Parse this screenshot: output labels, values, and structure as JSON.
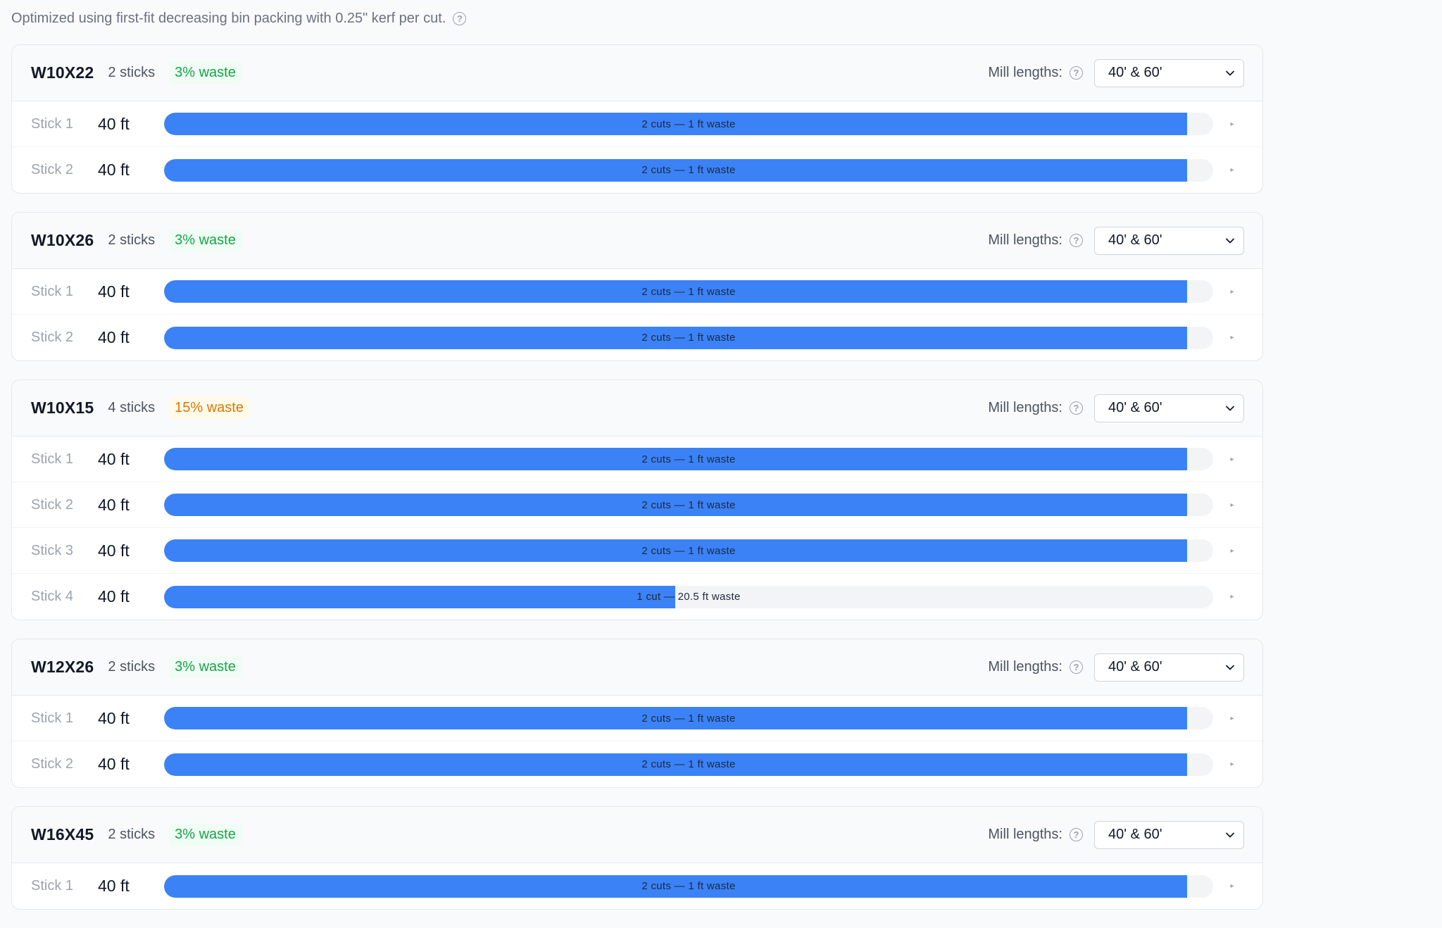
{
  "info": {
    "text": "Optimized using first-fit decreasing bin packing with 0.25\" kerf per cut."
  },
  "groups": [
    {
      "profile": "W10X22",
      "sticks_label": "2 sticks",
      "waste_label": "3% waste",
      "waste_level": "good",
      "mill_label": "Mill lengths:",
      "mill_value": "40' & 60'",
      "sticks": [
        {
          "name": "Stick 1",
          "length": "40 ft",
          "usage": 0.975,
          "label": "2 cuts — 1 ft waste"
        },
        {
          "name": "Stick 2",
          "length": "40 ft",
          "usage": 0.975,
          "label": "2 cuts — 1 ft waste"
        }
      ]
    },
    {
      "profile": "W10X26",
      "sticks_label": "2 sticks",
      "waste_label": "3% waste",
      "waste_level": "good",
      "mill_label": "Mill lengths:",
      "mill_value": "40' & 60'",
      "sticks": [
        {
          "name": "Stick 1",
          "length": "40 ft",
          "usage": 0.975,
          "label": "2 cuts — 1 ft waste"
        },
        {
          "name": "Stick 2",
          "length": "40 ft",
          "usage": 0.975,
          "label": "2 cuts — 1 ft waste"
        }
      ]
    },
    {
      "profile": "W10X15",
      "sticks_label": "4 sticks",
      "waste_label": "15% waste",
      "waste_level": "warn",
      "mill_label": "Mill lengths:",
      "mill_value": "40' & 60'",
      "sticks": [
        {
          "name": "Stick 1",
          "length": "40 ft",
          "usage": 0.975,
          "label": "2 cuts — 1 ft waste"
        },
        {
          "name": "Stick 2",
          "length": "40 ft",
          "usage": 0.975,
          "label": "2 cuts — 1 ft waste"
        },
        {
          "name": "Stick 3",
          "length": "40 ft",
          "usage": 0.975,
          "label": "2 cuts — 1 ft waste"
        },
        {
          "name": "Stick 4",
          "length": "40 ft",
          "usage": 0.4875,
          "label": "1 cut — 20.5 ft waste"
        }
      ]
    },
    {
      "profile": "W12X26",
      "sticks_label": "2 sticks",
      "waste_label": "3% waste",
      "waste_level": "good",
      "mill_label": "Mill lengths:",
      "mill_value": "40' & 60'",
      "sticks": [
        {
          "name": "Stick 1",
          "length": "40 ft",
          "usage": 0.975,
          "label": "2 cuts — 1 ft waste"
        },
        {
          "name": "Stick 2",
          "length": "40 ft",
          "usage": 0.975,
          "label": "2 cuts — 1 ft waste"
        }
      ]
    },
    {
      "profile": "W16X45",
      "sticks_label": "2 sticks",
      "waste_label": "3% waste",
      "waste_level": "good",
      "mill_label": "Mill lengths:",
      "mill_value": "40' & 60'",
      "sticks": [
        {
          "name": "Stick 1",
          "length": "40 ft",
          "usage": 0.975,
          "label": "2 cuts — 1 ft waste"
        }
      ]
    }
  ],
  "colors": {
    "bar_fill": "#3b82f6",
    "bar_track": "#f3f4f6",
    "waste_good": "#16a34a",
    "waste_warn": "#d97706"
  },
  "icons": {
    "help": "help-circle-icon",
    "select": "chevron-down-icon",
    "row_expand": "caret-right-icon"
  }
}
